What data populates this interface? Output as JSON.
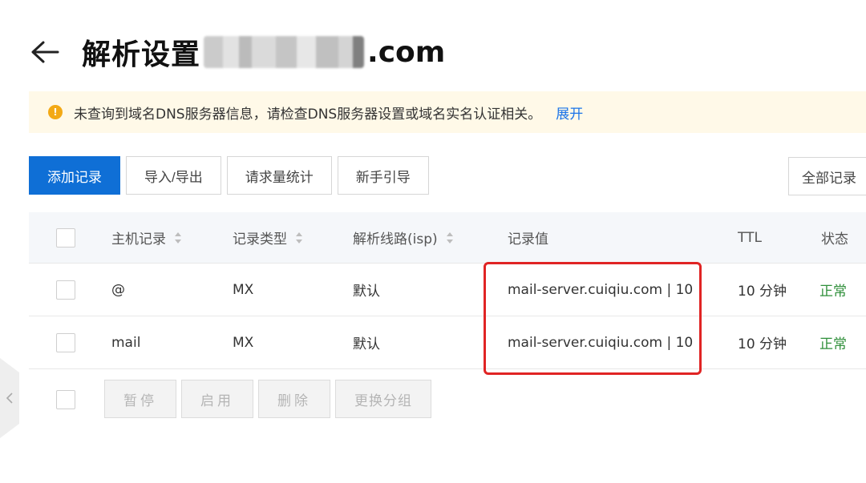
{
  "header": {
    "title": "解析设置",
    "domain_suffix": ".com"
  },
  "alert": {
    "icon": "warning-icon",
    "message": "未查询到域名DNS服务器信息，请检查DNS服务器设置或域名实名认证相关。",
    "link": "展开",
    "color": "#f3a915"
  },
  "toolbar": {
    "buttons": [
      "添加记录",
      "导入/导出",
      "请求量统计",
      "新手引导"
    ],
    "filter_button": "全部记录",
    "primary_color": "#0f6fd6"
  },
  "table": {
    "columns": [
      "主机记录",
      "记录类型",
      "解析线路(isp)",
      "记录值",
      "TTL",
      "状态"
    ],
    "rows": [
      {
        "host": "@",
        "type": "MX",
        "line": "默认",
        "value": "mail-server.cuiqiu.com | 10",
        "ttl": "10 分钟",
        "status": "正常"
      },
      {
        "host": "mail",
        "type": "MX",
        "line": "默认",
        "value": "mail-server.cuiqiu.com | 10",
        "ttl": "10 分钟",
        "status": "正常"
      }
    ]
  },
  "batch": {
    "buttons": [
      "暂停",
      "启用",
      "删除",
      "更换分组"
    ]
  }
}
